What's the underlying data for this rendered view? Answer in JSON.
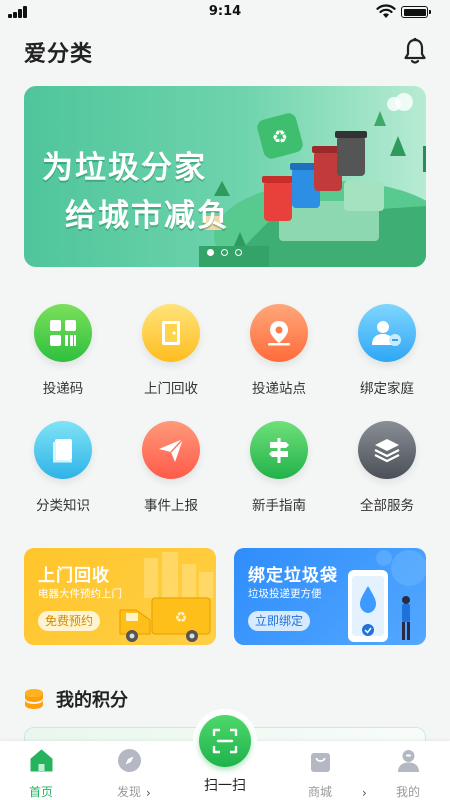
{
  "status": {
    "time": "9:14"
  },
  "header": {
    "title": "爱分类"
  },
  "banner": {
    "line1": "为垃圾分家",
    "line2": "给城市减负"
  },
  "services": [
    {
      "label": "投递码",
      "icon": "qr-grid-icon"
    },
    {
      "label": "上门回收",
      "icon": "door-icon"
    },
    {
      "label": "投递站点",
      "icon": "location-pin-icon"
    },
    {
      "label": "绑定家庭",
      "icon": "family-link-icon"
    },
    {
      "label": "分类知识",
      "icon": "book-icon"
    },
    {
      "label": "事件上报",
      "icon": "paper-plane-icon"
    },
    {
      "label": "新手指南",
      "icon": "signpost-icon"
    },
    {
      "label": "全部服务",
      "icon": "layers-icon"
    }
  ],
  "promos": {
    "recycle": {
      "title": "上门回收",
      "subtitle": "电器大件预约上门",
      "button": "免费预约"
    },
    "bag": {
      "title": "绑定垃圾袋",
      "subtitle": "垃圾投递更方便",
      "button": "立即绑定"
    }
  },
  "points": {
    "title": "我的积分"
  },
  "tabbar": {
    "home": "首页",
    "discover": "发现",
    "scan": "扫一扫",
    "mall": "商城",
    "mine": "我的"
  },
  "colors": {
    "brand_green": "#26b35e",
    "accent_yellow": "#ffc52b",
    "accent_blue": "#2f8dfb"
  }
}
